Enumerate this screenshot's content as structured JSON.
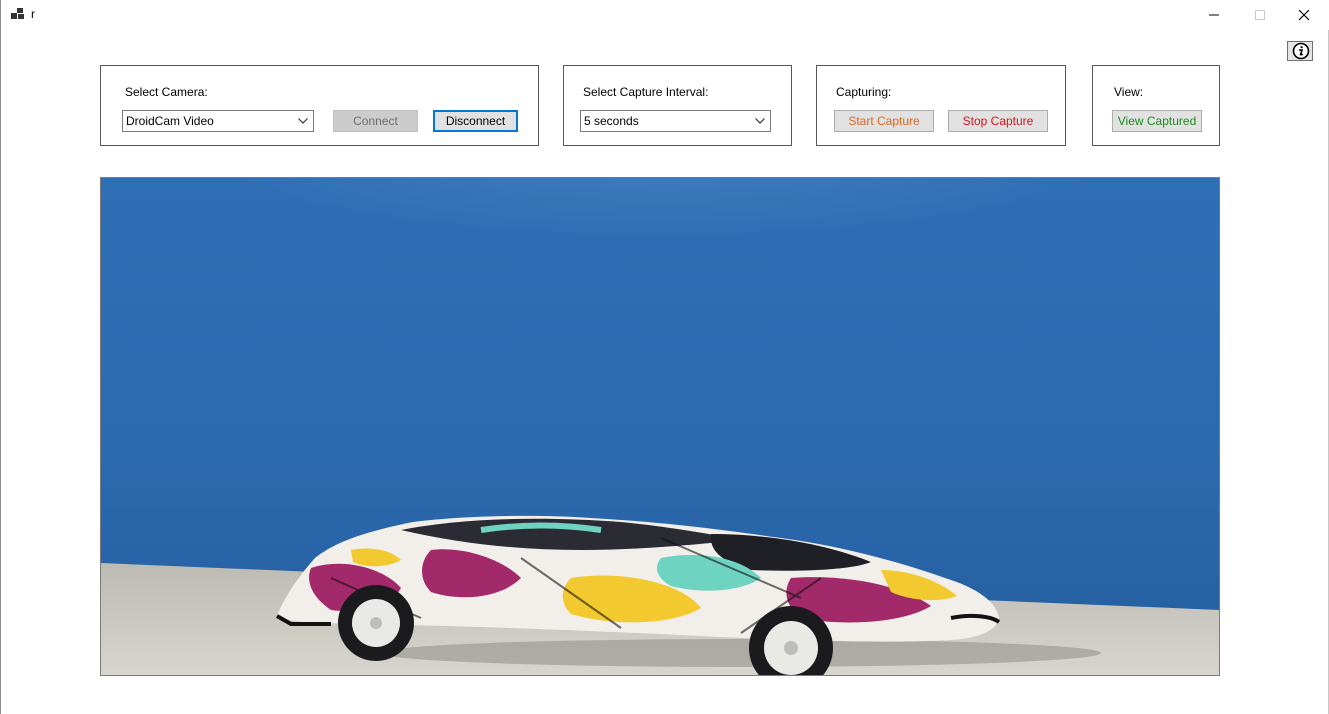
{
  "window": {
    "title": "r",
    "icons": {
      "app": "app-icon",
      "minimize": "minimize-icon",
      "maximize": "maximize-icon",
      "close": "close-icon",
      "info": "info-icon"
    }
  },
  "camera_group": {
    "label": "Select Camera:",
    "selected_camera": "DroidCam Video",
    "connect_label": "Connect",
    "disconnect_label": "Disconnect"
  },
  "interval_group": {
    "label": "Select Capture Interval:",
    "selected_interval": "5 seconds"
  },
  "capture_group": {
    "label": "Capturing:",
    "start_label": "Start Capture",
    "stop_label": "Stop Capture"
  },
  "view_group": {
    "label": "View:",
    "view_captured_label": "View Captured"
  },
  "colors": {
    "start_text": "#e0661f",
    "stop_text": "#e0101a",
    "view_text": "#1e8a1e",
    "focus_border": "#0078d7"
  }
}
